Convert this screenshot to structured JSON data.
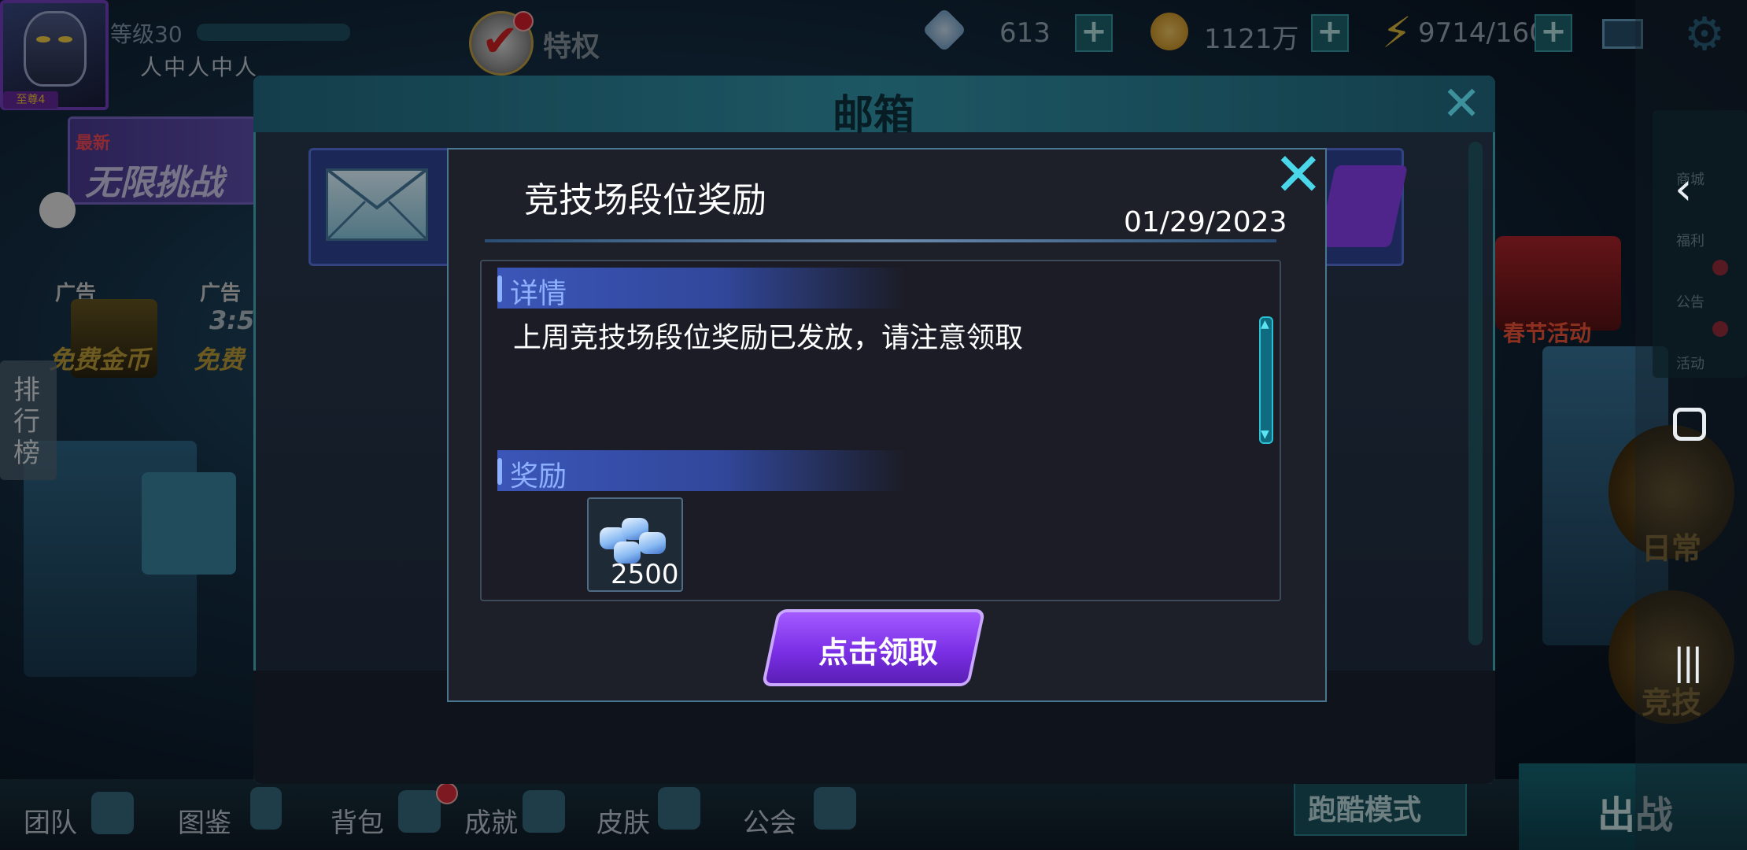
{
  "header": {
    "rank_badge": "至尊4",
    "level_label": "等级30",
    "player_name": "人中人中人",
    "vip_label": "特权",
    "diamonds": "613",
    "gold": "1121万",
    "energy": "9714/160"
  },
  "left_side": {
    "banner_tag": "最新",
    "banner_title": "无限挑战",
    "ad_label_1": "广告",
    "ad_sub_1": "免费金币",
    "ad_label_2": "广告",
    "ad_timer": "3:5",
    "ad_sub_2": "免费",
    "rank_label": "排行榜"
  },
  "right_side": {
    "items": [
      "商城",
      "福利",
      "公告",
      "活动"
    ],
    "spring_event": "春节活动",
    "daily": "日常",
    "arena": "竞技"
  },
  "bottom_nav": {
    "items": [
      "团队",
      "图鉴",
      "背包",
      "成就",
      "皮肤",
      "公会"
    ],
    "run_mode": "跑酷模式",
    "fight": "出战"
  },
  "mailbox": {
    "title": "邮箱"
  },
  "dialog": {
    "title": "竞技场段位奖励",
    "date": "01/29/2023",
    "detail_header": "详情",
    "detail_text": "上周竞技场段位奖励已发放，请注意领取",
    "reward_header": "奖励",
    "reward_count": "2500",
    "claim_label": "点击领取"
  },
  "icons": {
    "close": "close-icon",
    "mail": "envelope-icon",
    "diamond": "diamond-icon",
    "gold": "gold-coin-icon",
    "energy": "lightning-icon",
    "settings": "gear-icon"
  },
  "colors": {
    "accent_cyan": "#4ad7ea",
    "claim_purple": "#7b2fe6",
    "section_blue": "#3b56b8"
  }
}
